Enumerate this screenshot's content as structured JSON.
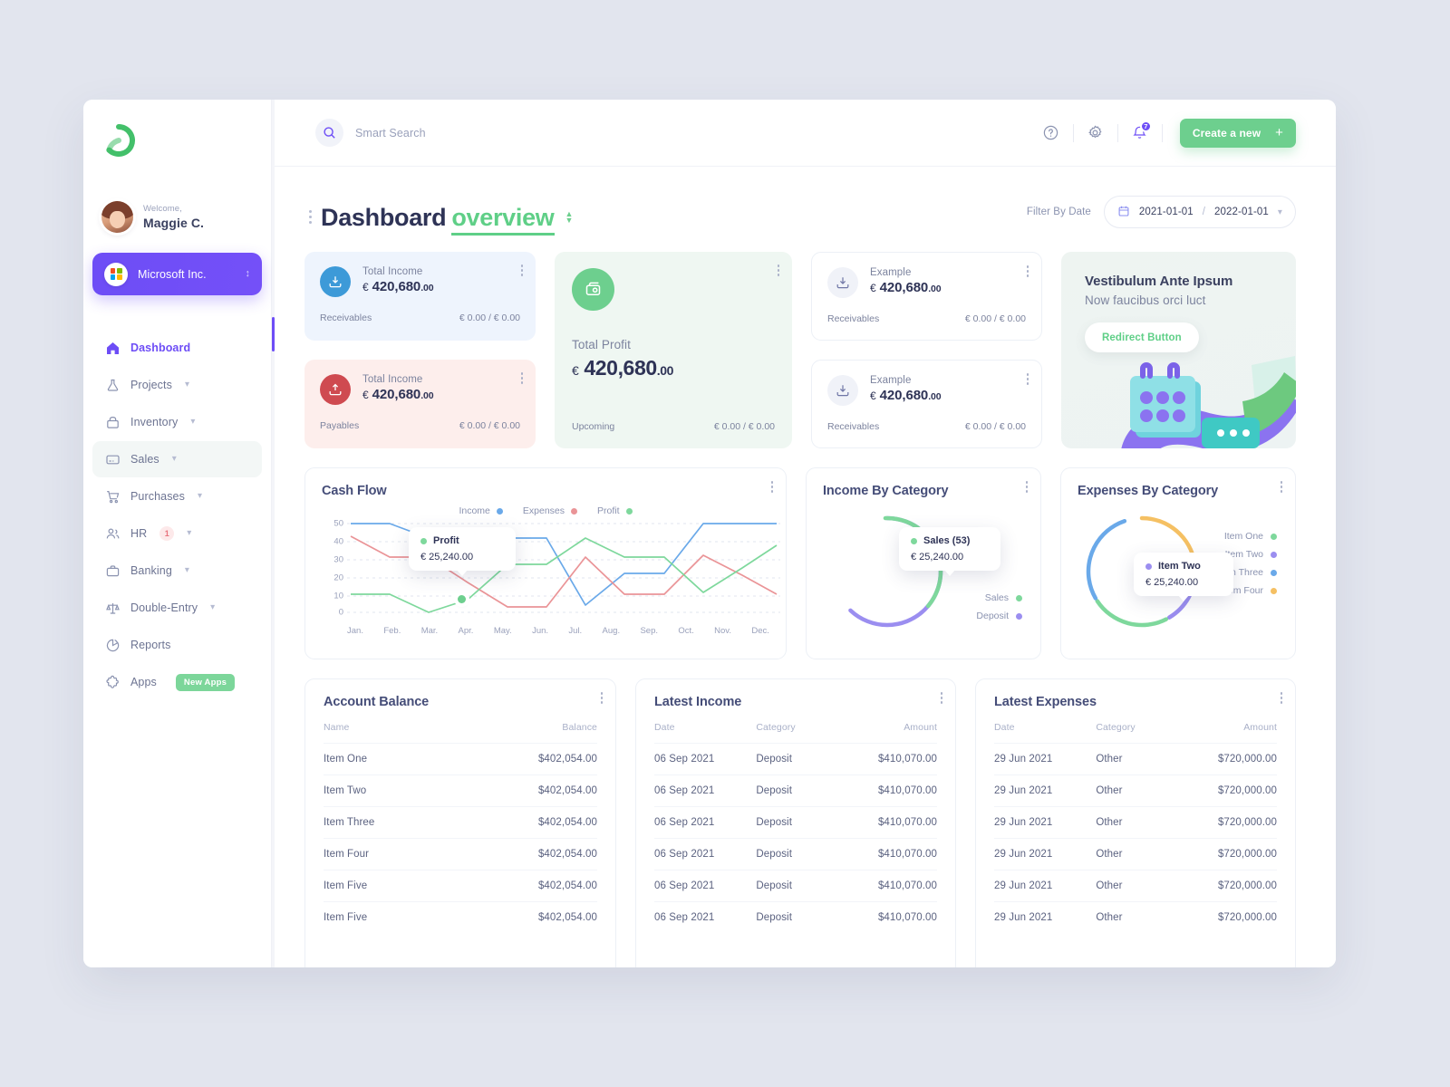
{
  "sidebar": {
    "logo_name": "app-logo",
    "welcome_label": "Welcome,",
    "user_name": "Maggie C.",
    "org_name": "Microsoft Inc.",
    "items": [
      {
        "label": "Dashboard",
        "icon": "home-icon",
        "caret": false,
        "state": "active"
      },
      {
        "label": "Projects",
        "icon": "flask-icon",
        "caret": true,
        "state": ""
      },
      {
        "label": "Inventory",
        "icon": "box-icon",
        "caret": true,
        "state": ""
      },
      {
        "label": "Sales",
        "icon": "card-icon",
        "caret": true,
        "state": "sel"
      },
      {
        "label": "Purchases",
        "icon": "cart-icon",
        "caret": true,
        "state": ""
      },
      {
        "label": "HR",
        "icon": "people-icon",
        "caret": true,
        "state": "",
        "badge": "1"
      },
      {
        "label": "Banking",
        "icon": "briefcase-icon",
        "caret": true,
        "state": ""
      },
      {
        "label": "Double-Entry",
        "icon": "scales-icon",
        "caret": true,
        "state": ""
      },
      {
        "label": "Reports",
        "icon": "piechart-icon",
        "caret": false,
        "state": ""
      },
      {
        "label": "Apps",
        "icon": "puzzle-icon",
        "caret": false,
        "state": "",
        "tag": "New Apps"
      }
    ]
  },
  "topbar": {
    "search_placeholder": "Smart Search",
    "search_value": "",
    "help_icon": "help-icon",
    "settings_icon": "gear-icon",
    "bell_icon": "bell-icon",
    "notification_count": "7",
    "create_label": "Create a new",
    "create_plus": "+"
  },
  "page": {
    "title": "Dashboard",
    "title_accent": "overview",
    "filter_label": "Filter By Date",
    "date_from": "2021-01-01",
    "date_separator": "/",
    "date_to": "2022-01-01"
  },
  "stats": {
    "income": {
      "label": "Total Income",
      "currency": "€",
      "amount": "420,680",
      "decimals": ".00",
      "foot_key": "Receivables",
      "foot_val": "€ 0.00 / € 0.00"
    },
    "payables": {
      "label": "Total Income",
      "currency": "€",
      "amount": "420,680",
      "decimals": ".00",
      "foot_key": "Payables",
      "foot_val": "€ 0.00 / € 0.00"
    },
    "profit": {
      "label": "Total Profit",
      "currency": "€",
      "amount": "420,680",
      "decimals": ".00",
      "foot_key": "Upcoming",
      "foot_val": "€ 0.00 / € 0.00"
    },
    "example_one": {
      "label": "Example",
      "currency": "€",
      "amount": "420,680",
      "decimals": ".00",
      "foot_key": "Receivables",
      "foot_val": "€ 0.00 / € 0.00"
    },
    "example_two": {
      "label": "Example",
      "currency": "€",
      "amount": "420,680",
      "decimals": ".00",
      "foot_key": "Receivables",
      "foot_val": "€ 0.00 / € 0.00"
    }
  },
  "promo": {
    "heading": "Vestibulum Ante Ipsum",
    "subheading": "Now faucibus orci luct",
    "button_label": "Redirect Button"
  },
  "chart_data": [
    {
      "type": "line",
      "card_title": "Cash Flow",
      "title": "Cash Flow",
      "xlabel": "",
      "ylabel": "",
      "ylim": [
        0,
        50
      ],
      "grid": true,
      "legend_position": "top-center",
      "categories": [
        "Jan.",
        "Feb.",
        "Mar.",
        "Apr.",
        "May.",
        "Jun.",
        "Jul.",
        "Aug.",
        "Sep.",
        "Oct.",
        "Nov.",
        "Dec."
      ],
      "series": [
        {
          "name": "Income",
          "color": "#6aa9e9",
          "values": [
            50,
            50,
            42,
            42,
            42,
            42,
            4,
            22,
            22,
            50,
            50,
            50
          ]
        },
        {
          "name": "Expenses",
          "color": "#ea9497",
          "values": [
            43,
            31,
            31,
            17,
            3,
            3,
            31,
            10,
            10,
            32,
            21,
            10
          ]
        },
        {
          "name": "Profit",
          "color": "#7ed89c",
          "values": [
            10,
            10,
            0,
            7,
            27,
            27,
            42,
            31,
            31,
            11,
            25,
            38
          ]
        }
      ],
      "tooltip": {
        "series": "Profit",
        "value": "€ 25,240.00",
        "at_category": "Apr."
      }
    },
    {
      "type": "pie",
      "card_title": "Income By Category",
      "title": "Income By Category",
      "labels": [
        "Sales",
        "Deposit"
      ],
      "colors": [
        "#7ed89c",
        "#9b8ef0"
      ],
      "values": [
        38,
        62
      ],
      "legend_position": "right",
      "tooltip": {
        "label": "Sales (53)",
        "value": "€ 25,240.00",
        "color": "#7ed89c"
      }
    },
    {
      "type": "pie",
      "card_title": "Expenses By Category",
      "title": "Expenses By Category",
      "labels": [
        "Item One",
        "Item Two",
        "Item Three",
        "Item Four"
      ],
      "colors": [
        "#7ed89c",
        "#9b8ef0",
        "#6aa9e9",
        "#f5c063"
      ],
      "values": [
        22,
        20,
        28,
        30
      ],
      "legend_position": "right",
      "tooltip": {
        "label": "Item Two",
        "value": "€ 25,240.00",
        "color": "#9b8ef0"
      }
    }
  ],
  "tables": {
    "account_balance": {
      "title": "Account Balance",
      "columns": [
        "Name",
        "Balance"
      ],
      "rows": [
        [
          "Item One",
          "$402,054.00"
        ],
        [
          "Item Two",
          "$402,054.00"
        ],
        [
          "Item Three",
          "$402,054.00"
        ],
        [
          "Item Four",
          "$402,054.00"
        ],
        [
          "Item Five",
          "$402,054.00"
        ],
        [
          "Item Five",
          "$402,054.00"
        ]
      ]
    },
    "latest_income": {
      "title": "Latest Income",
      "columns": [
        "Date",
        "Category",
        "Amount"
      ],
      "rows": [
        [
          "06 Sep 2021",
          "Deposit",
          "$410,070.00"
        ],
        [
          "06 Sep 2021",
          "Deposit",
          "$410,070.00"
        ],
        [
          "06 Sep 2021",
          "Deposit",
          "$410,070.00"
        ],
        [
          "06 Sep 2021",
          "Deposit",
          "$410,070.00"
        ],
        [
          "06 Sep 2021",
          "Deposit",
          "$410,070.00"
        ],
        [
          "06 Sep 2021",
          "Deposit",
          "$410,070.00"
        ]
      ]
    },
    "latest_expenses": {
      "title": "Latest Expenses",
      "columns": [
        "Date",
        "Category",
        "Amount"
      ],
      "rows": [
        [
          "29 Jun 2021",
          "Other",
          "$720,000.00"
        ],
        [
          "29 Jun 2021",
          "Other",
          "$720,000.00"
        ],
        [
          "29 Jun 2021",
          "Other",
          "$720,000.00"
        ],
        [
          "29 Jun 2021",
          "Other",
          "$720,000.00"
        ],
        [
          "29 Jun 2021",
          "Other",
          "$720,000.00"
        ],
        [
          "29 Jun 2021",
          "Other",
          "$720,000.00"
        ]
      ]
    }
  },
  "colors": {
    "brand_purple": "#6d4df6",
    "brand_green": "#6dcf8e",
    "income_blue": "#6aa9e9",
    "expenses_red": "#ea9497",
    "profit_green": "#7ed89c"
  }
}
